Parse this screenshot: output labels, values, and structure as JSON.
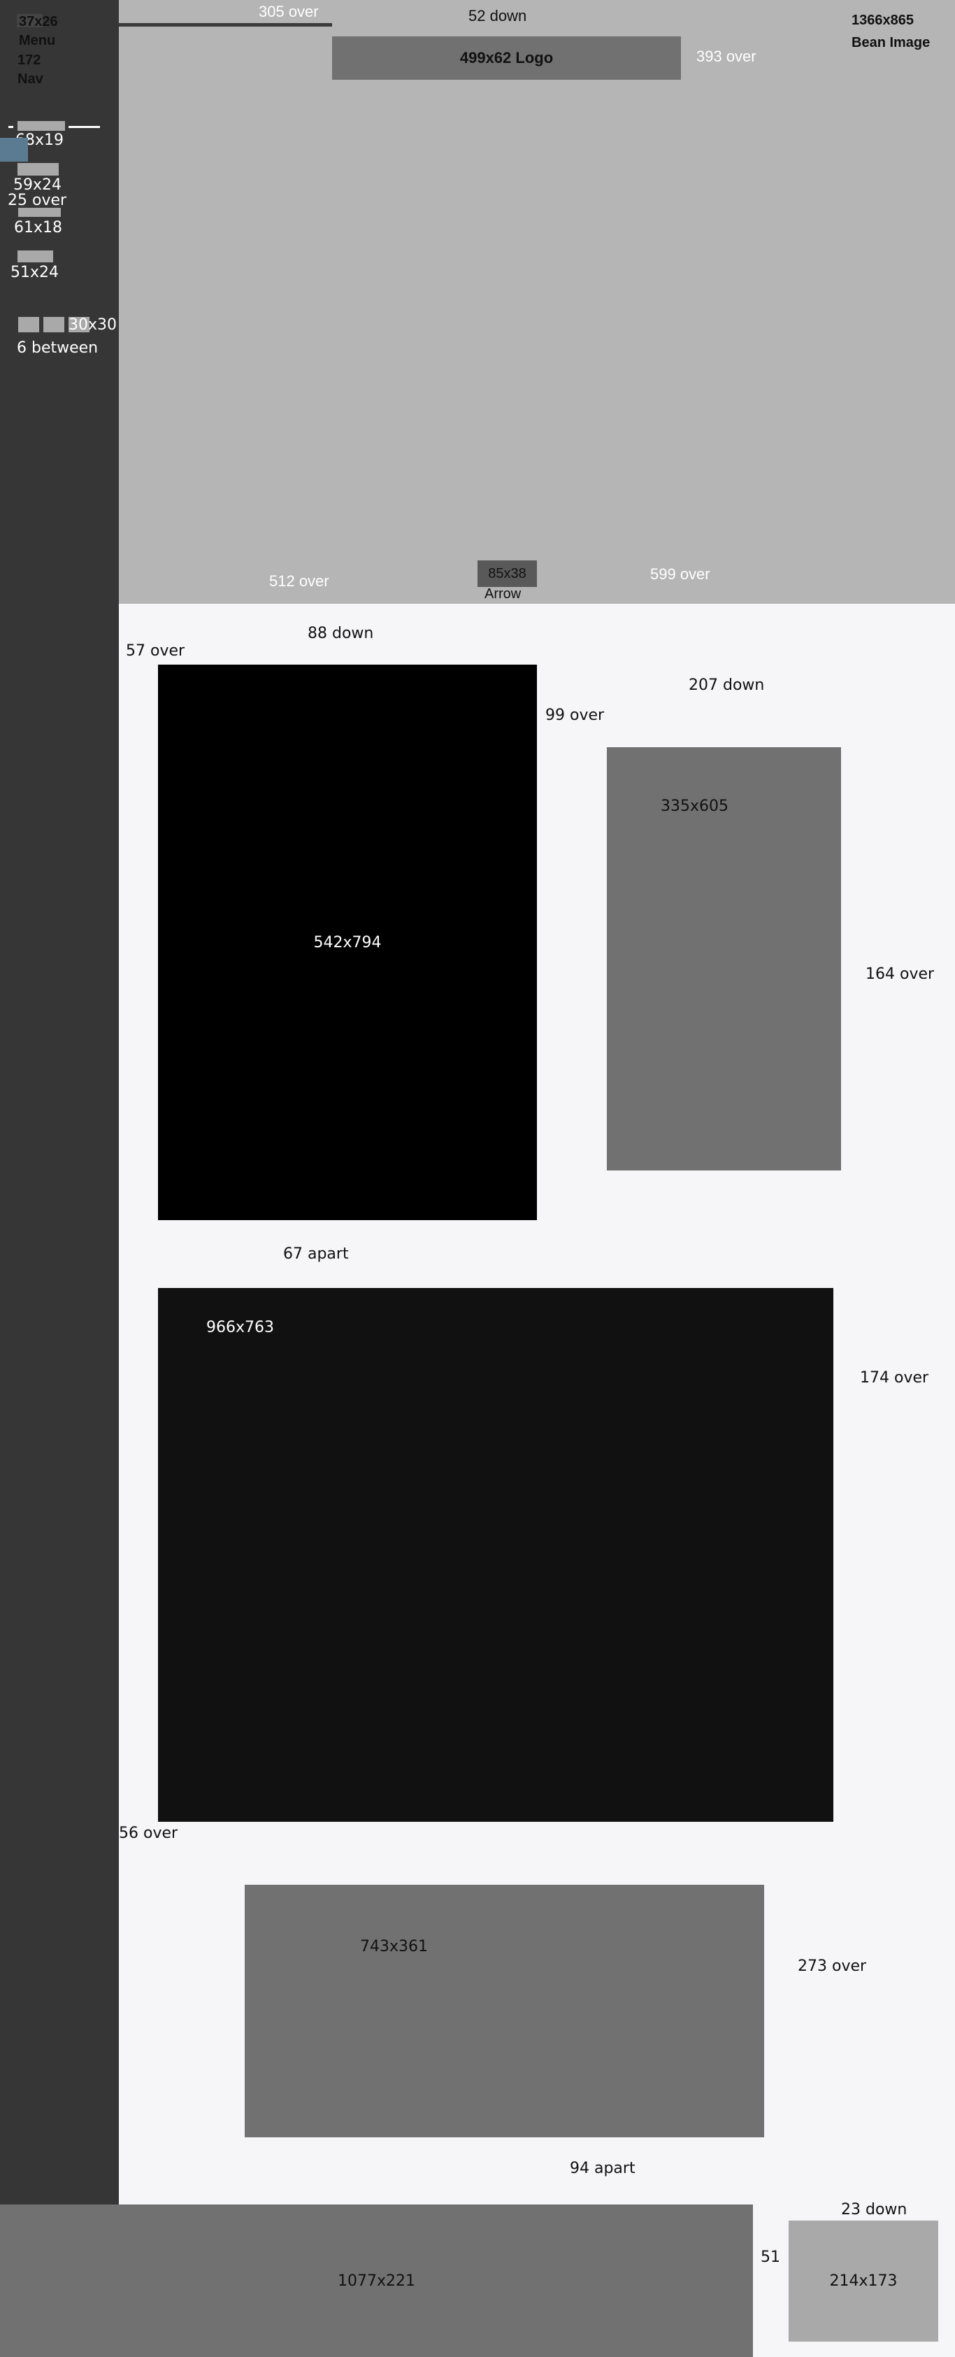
{
  "sidebar": {
    "menu_size": "37x26",
    "menu_label": "Menu",
    "nav_size": "172",
    "nav_label": "Nav",
    "item1_size": "68x19",
    "item2_size": "59x24",
    "item2_gap": "25 over",
    "item3_size": "61x18",
    "item4_size": "51x24",
    "icons_size": "30x30",
    "icons_gap": "6 between"
  },
  "hero": {
    "line_label": "305 over",
    "logo_top": "52 down",
    "logo_label": "499x62 Logo",
    "logo_right": "393 over",
    "image_size": "1366x865",
    "image_label": "Bean Image",
    "arrow_left": "512 over",
    "arrow_size": "85x38",
    "arrow_label": "Arrow",
    "arrow_right": "599 over"
  },
  "main": {
    "top_gap": "88 down",
    "left_gap": "57 over",
    "block1": "542x794",
    "block1_right": "99 over",
    "block2_top": "207 down",
    "block2": "335x605",
    "block2_right": "164 over",
    "gap1": "67 apart",
    "block3": "966x763",
    "block3_right": "174 over",
    "block3_left": "56 over",
    "block4": "743x361",
    "block4_right": "273 over",
    "gap2": "94 apart"
  },
  "footer": {
    "block": "1077x221",
    "gap": "51",
    "top_gap": "23 down",
    "box": "214x173"
  },
  "colors": {
    "sidebar": "#363636",
    "hero": "#b5b5b5",
    "main": "#f6f6f8",
    "accent": "#5a7b91"
  }
}
